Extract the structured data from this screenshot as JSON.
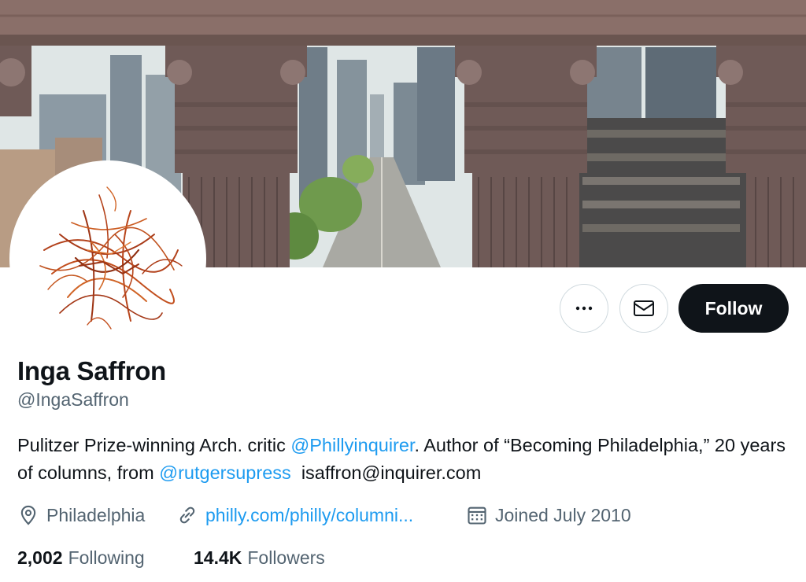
{
  "profile": {
    "name": "Inga Saffron",
    "handle": "@IngaSaffron",
    "bio": {
      "part1": "Pulitzer Prize-winning Arch. critic ",
      "mention1": "@Phillyinquirer",
      "part2": ". Author of “Becoming Philadelphia,” 20 years of columns, from ",
      "mention2": "@rutgersupress",
      "part3": "  isaffron@inquirer.com"
    },
    "location": "Philadelphia",
    "website": "philly.com/philly/columni...",
    "joined": "Joined July 2010",
    "following_count": "2,002",
    "following_label": "Following",
    "followers_count": "14.4K",
    "followers_label": "Followers"
  },
  "actions": {
    "follow_label": "Follow"
  },
  "icons": {
    "more": "more-icon",
    "message": "envelope-icon",
    "location": "location-pin-icon",
    "link": "link-icon",
    "calendar": "calendar-icon"
  },
  "colors": {
    "link": "#1d9bf0",
    "secondary_text": "#536471",
    "follow_button": "#0f1419"
  }
}
